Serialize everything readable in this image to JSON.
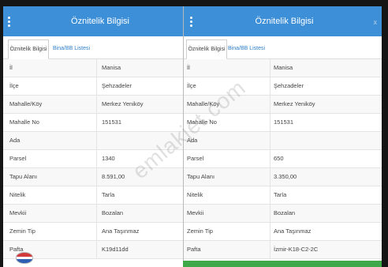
{
  "panels": [
    {
      "title": "Öznitelik Bilgisi",
      "menu_icon": "more-vertical-icon",
      "tabs": [
        {
          "label": "Öznitelik Bilgisi",
          "active": true
        },
        {
          "label": "Bina/BB Listesi",
          "active": false
        }
      ],
      "rows": [
        {
          "label": "İl",
          "value": "Manisa"
        },
        {
          "label": "İlçe",
          "value": "Şehzadeler"
        },
        {
          "label": "Mahalle/Köy",
          "value": "Merkez Yeniköy"
        },
        {
          "label": "Mahalle No",
          "value": "151531"
        },
        {
          "label": "Ada",
          "value": ""
        },
        {
          "label": "Parsel",
          "value": "1340"
        },
        {
          "label": "Tapu Alanı",
          "value": "8.591,00"
        },
        {
          "label": "Nitelik",
          "value": "Tarla"
        },
        {
          "label": "Mevkii",
          "value": "Bozalan"
        },
        {
          "label": "Zemin Tip",
          "value": "Ana Taşınmaz"
        },
        {
          "label": "Pafta",
          "value": "K19d11dd"
        }
      ]
    },
    {
      "title": "Öznitelik Bilgisi",
      "menu_icon": "more-vertical-icon",
      "close_label": "x",
      "close_icon": "close-icon",
      "tabs": [
        {
          "label": "Öznitelik Bilgisi",
          "active": true
        },
        {
          "label": "Bina/BB Listesi",
          "active": false
        }
      ],
      "rows": [
        {
          "label": "İl",
          "value": "Manisa"
        },
        {
          "label": "İlçe",
          "value": "Şehzadeler"
        },
        {
          "label": "Mahalle/Köy",
          "value": "Merkez Yeniköy"
        },
        {
          "label": "Mahalle No",
          "value": "151531"
        },
        {
          "label": "Ada",
          "value": ""
        },
        {
          "label": "Parsel",
          "value": "650"
        },
        {
          "label": "Tapu Alanı",
          "value": "3.350,00"
        },
        {
          "label": "Nitelik",
          "value": "Tarla"
        },
        {
          "label": "Mevkii",
          "value": "Bozalan"
        },
        {
          "label": "Zemin Tip",
          "value": "Ana Taşınmaz"
        },
        {
          "label": "Pafta",
          "value": "İzmir-K18-C2-2C"
        }
      ]
    }
  ],
  "watermark": "emlakjet.com",
  "colors": {
    "header": "#3d8fd8",
    "tab_link": "#2f7fc8",
    "footer_bar": "#3fa94a",
    "frame": "#151515"
  }
}
